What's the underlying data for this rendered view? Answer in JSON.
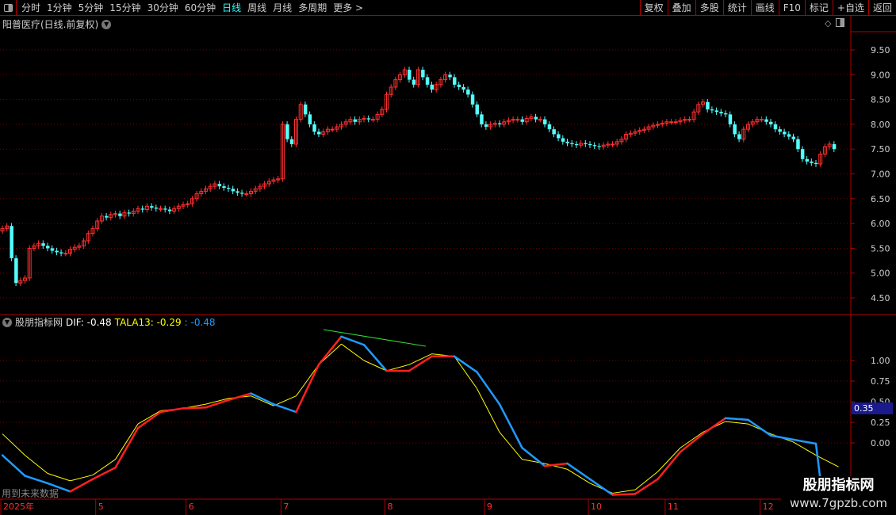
{
  "toolbar": {
    "periods": [
      "分时",
      "1分钟",
      "5分钟",
      "15分钟",
      "30分钟",
      "60分钟",
      "日线",
      "周线",
      "月线",
      "多周期",
      "更多 >"
    ],
    "active_period": "日线",
    "right_buttons": [
      "复权",
      "叠加",
      "多股",
      "统计",
      "画线",
      "F10",
      "标记",
      "+自选",
      "返回"
    ]
  },
  "chart_title": "阳普医疗(日线.前复权)",
  "indicator": {
    "name": "股朋指标网",
    "dif_label": "DIF: -0.48",
    "tala_label": "TALA13: -0.29",
    "third_label": ": -0.48",
    "highlight_value": "0.35"
  },
  "future_text": "用到未来数据",
  "watermark": {
    "line1": "股朋指标网",
    "line2": "www.7gpzb.com"
  },
  "colors": {
    "up": "#ff3030",
    "down": "#54ffff",
    "dif_up": "#ff2020",
    "dif_down": "#1e9bff",
    "tala": "#ffff00",
    "grid": "#7a0000",
    "border": "#b00000"
  },
  "chart_data": [
    {
      "type": "candlestick",
      "price_ticks": [
        9.5,
        9.0,
        8.5,
        8.0,
        7.5,
        7.0,
        6.5,
        6.0,
        5.5,
        5.0,
        4.5
      ],
      "price_tick_labels": [
        "9.50",
        "9.00",
        "8.50",
        "8.00",
        "7.50",
        "7.00",
        "6.50",
        "6.00",
        "5.50",
        "5.00",
        "4.50"
      ],
      "ylim": [
        4.3,
        9.9
      ],
      "time_labels": [
        {
          "label": "2025年",
          "index": 0
        },
        {
          "label": "5",
          "index": 21
        },
        {
          "label": "6",
          "index": 41
        },
        {
          "label": "7",
          "index": 62
        },
        {
          "label": "8",
          "index": 85
        },
        {
          "label": "9",
          "index": 107
        },
        {
          "label": "10",
          "index": 130
        },
        {
          "label": "11",
          "index": 147
        },
        {
          "label": "12",
          "index": 168
        }
      ],
      "closes": [
        5.9,
        5.95,
        5.3,
        4.8,
        4.85,
        4.9,
        5.5,
        5.55,
        5.6,
        5.55,
        5.5,
        5.45,
        5.42,
        5.4,
        5.4,
        5.48,
        5.52,
        5.55,
        5.65,
        5.8,
        5.9,
        6.05,
        6.15,
        6.12,
        6.18,
        6.2,
        6.15,
        6.22,
        6.2,
        6.25,
        6.3,
        6.28,
        6.35,
        6.32,
        6.3,
        6.3,
        6.28,
        6.25,
        6.3,
        6.35,
        6.38,
        6.4,
        6.5,
        6.6,
        6.65,
        6.7,
        6.75,
        6.8,
        6.75,
        6.72,
        6.7,
        6.65,
        6.62,
        6.6,
        6.6,
        6.65,
        6.7,
        6.75,
        6.8,
        6.85,
        6.88,
        6.9,
        8.0,
        7.7,
        7.6,
        8.1,
        8.4,
        8.2,
        8.0,
        7.85,
        7.8,
        7.85,
        7.9,
        7.9,
        7.95,
        8.0,
        8.05,
        8.1,
        8.05,
        8.1,
        8.12,
        8.1,
        8.1,
        8.2,
        8.3,
        8.6,
        8.75,
        8.9,
        9.0,
        9.1,
        8.9,
        8.8,
        9.1,
        8.95,
        8.8,
        8.7,
        8.8,
        8.9,
        9.0,
        8.95,
        8.8,
        8.75,
        8.7,
        8.6,
        8.4,
        8.2,
        8.0,
        7.95,
        8.0,
        8.02,
        8.0,
        8.05,
        8.08,
        8.1,
        8.1,
        8.05,
        8.12,
        8.15,
        8.1,
        8.1,
        8.0,
        7.9,
        7.8,
        7.72,
        7.65,
        7.62,
        7.6,
        7.58,
        7.62,
        7.6,
        7.58,
        7.56,
        7.55,
        7.58,
        7.6,
        7.6,
        7.65,
        7.7,
        7.8,
        7.82,
        7.85,
        7.88,
        7.9,
        7.95,
        7.98,
        8.0,
        8.02,
        8.05,
        8.05,
        8.05,
        8.08,
        8.1,
        8.1,
        8.25,
        8.4,
        8.45,
        8.3,
        8.28,
        8.25,
        8.22,
        8.2,
        8.0,
        7.8,
        7.7,
        7.9,
        8.0,
        8.05,
        8.1,
        8.1,
        8.05,
        8.0,
        7.9,
        7.85,
        7.8,
        7.75,
        7.7,
        7.5,
        7.3,
        7.25,
        7.22,
        7.2,
        7.4,
        7.55,
        7.6,
        7.5
      ]
    },
    {
      "type": "line",
      "ticks": [
        1.0,
        0.75,
        0.5,
        0.25,
        0.0
      ],
      "tick_labels": [
        "1.00",
        "0.75",
        "0.50",
        "0.25",
        "0.00"
      ],
      "ylim": [
        -0.75,
        1.5
      ],
      "sample_every_candles": 5,
      "series": [
        {
          "name": "DIF",
          "values": [
            -0.15,
            -0.4,
            -0.49,
            -0.59,
            -0.44,
            -0.3,
            0.18,
            0.375,
            0.42,
            0.43,
            0.52,
            0.6,
            0.47,
            0.375,
            0.95,
            1.29,
            1.19,
            0.875,
            0.875,
            1.05,
            1.05,
            0.86,
            0.47,
            -0.06,
            -0.28,
            -0.25,
            -0.44,
            -0.63,
            -0.62,
            -0.44,
            -0.11,
            0.11,
            0.3,
            0.28,
            0.09,
            0.04,
            -0.01,
            -0.48
          ]
        },
        {
          "name": "TALA13",
          "values": [
            0.11,
            -0.15,
            -0.37,
            -0.46,
            -0.39,
            -0.2,
            0.23,
            0.39,
            0.42,
            0.47,
            0.54,
            0.57,
            0.45,
            0.57,
            0.95,
            1.2,
            1.0,
            0.875,
            0.95,
            1.08,
            1.05,
            0.66,
            0.13,
            -0.2,
            -0.25,
            -0.32,
            -0.49,
            -0.61,
            -0.57,
            -0.35,
            -0.06,
            0.13,
            0.26,
            0.23,
            0.11,
            0.01,
            -0.15,
            -0.29
          ]
        }
      ]
    }
  ]
}
